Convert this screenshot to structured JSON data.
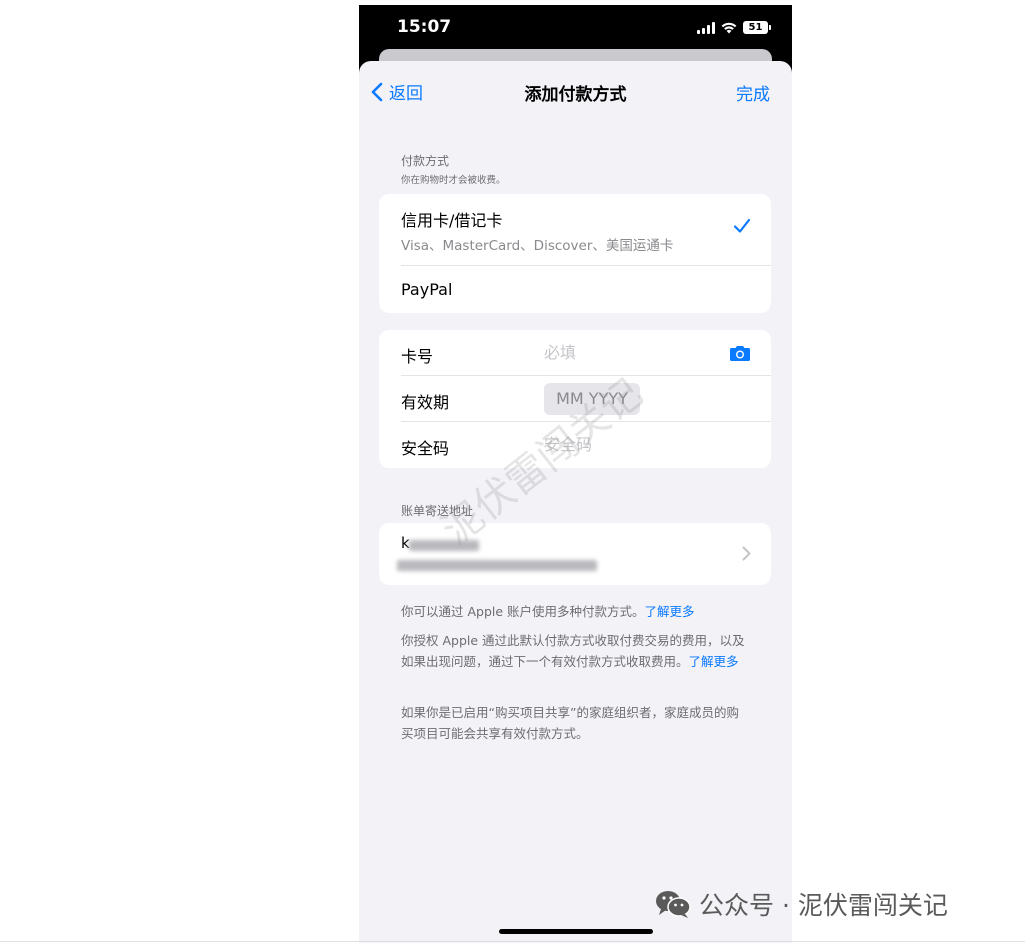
{
  "status": {
    "time": "15:07",
    "battery": "51"
  },
  "nav": {
    "back_label": "返回",
    "title": "添加付款方式",
    "done_label": "完成"
  },
  "payment_section": {
    "header": "付款方式",
    "subheader": "你在购物时才会被收费。"
  },
  "payment_methods": [
    {
      "title": "信用卡/借记卡",
      "subtitle": "Visa、MasterCard、Discover、美国运通卡",
      "selected": true
    },
    {
      "title": "PayPal",
      "selected": false
    }
  ],
  "card_form": {
    "card_number_label": "卡号",
    "card_number_placeholder": "必填",
    "expiry_label": "有效期",
    "expiry_placeholder": "MM YYYY",
    "cvv_label": "安全码",
    "cvv_placeholder": "安全码"
  },
  "billing": {
    "header": "账单寄送地址",
    "name_initial": "k"
  },
  "footer": {
    "p1": "你可以通过 Apple 账户使用多种付款方式。",
    "p1_link": "了解更多",
    "p2": "你授权 Apple 通过此默认付款方式收取付费交易的费用，以及如果出现问题，通过下一个有效付款方式收取费用。",
    "p2_link": "了解更多",
    "p3": "如果你是已启用“购买项目共享”的家庭组织者，家庭成员的购买项目可能会共享有效付款方式。"
  },
  "watermark": {
    "text": "公众号 · 泥伏雷闯关记",
    "diagonal": "泥伏雷闯关记"
  },
  "colors": {
    "accent": "#0a7aff",
    "background": "#f2f2f7",
    "card": "#ffffff",
    "secondary_text": "#6d6d72"
  }
}
